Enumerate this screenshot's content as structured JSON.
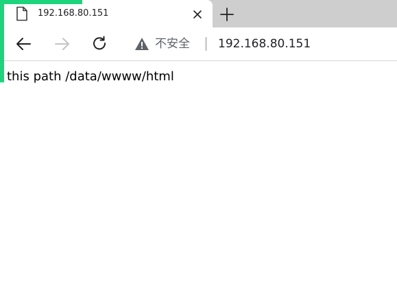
{
  "tab": {
    "title": "192.168.80.151"
  },
  "omnibox": {
    "security_label": "不安全",
    "url": "192.168.80.151"
  },
  "page": {
    "text": "this path /data/wwww/html"
  },
  "icons": {
    "favicon": "page-icon",
    "tab_close": "close-icon",
    "new_tab": "plus-icon",
    "back": "arrow-left-icon",
    "forward": "arrow-right-icon",
    "reload": "reload-icon",
    "security": "warning-icon"
  },
  "colors": {
    "tabstrip": "#cecece",
    "accent": "#1bd47c",
    "forward_disabled": "#c4c4c4"
  }
}
